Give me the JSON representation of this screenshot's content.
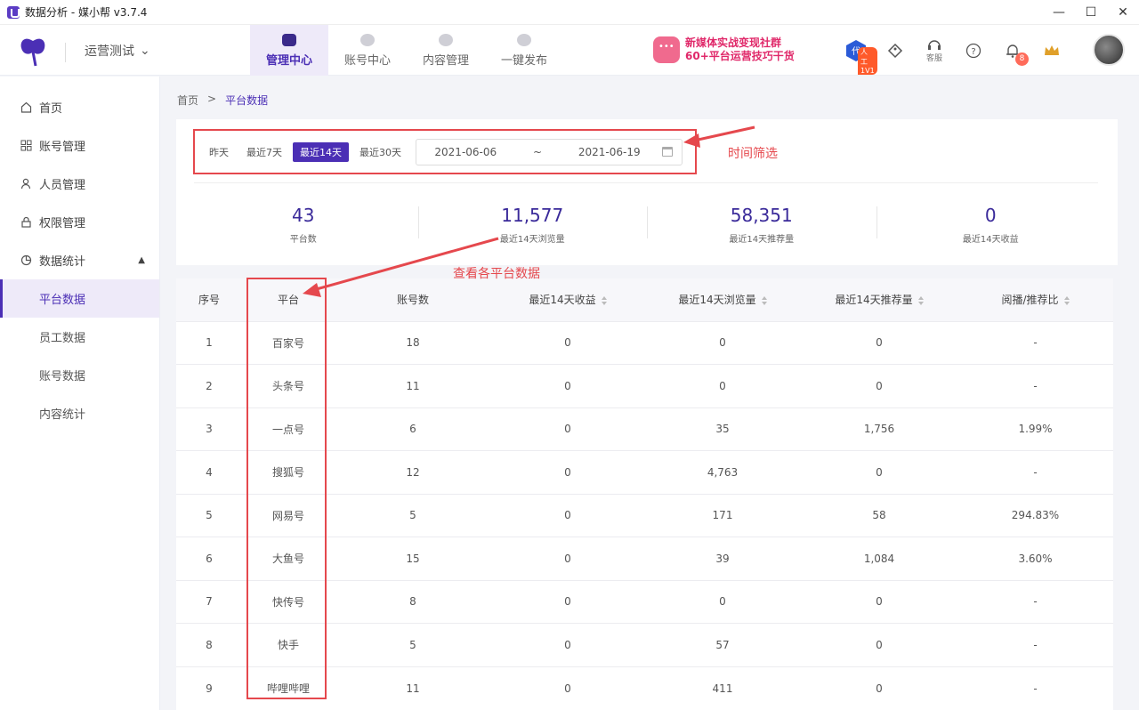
{
  "window": {
    "title": "数据分析 - 媒小帮 v3.7.4",
    "controls": [
      "—",
      "☐",
      "✕"
    ]
  },
  "header": {
    "org_label": "运营测试",
    "nav": [
      {
        "label": "管理中心",
        "icon": "monitor-icon",
        "active": true
      },
      {
        "label": "账号中心",
        "icon": "user-icon",
        "active": false
      },
      {
        "label": "内容管理",
        "icon": "document-icon",
        "active": false
      },
      {
        "label": "一键发布",
        "icon": "play-icon",
        "active": false
      }
    ],
    "promo_line1": "新媒体实战变现社群",
    "promo_line2": "60+平台运营技巧干货",
    "ai_badge": "人工1V1",
    "service_label": "客服",
    "notification_count": "8"
  },
  "sidebar": {
    "items": [
      {
        "label": "首页",
        "icon": "home-icon"
      },
      {
        "label": "账号管理",
        "icon": "grid-icon"
      },
      {
        "label": "人员管理",
        "icon": "person-icon"
      },
      {
        "label": "权限管理",
        "icon": "lock-icon"
      },
      {
        "label": "数据统计",
        "icon": "chart-icon"
      }
    ],
    "sub_items": [
      {
        "label": "平台数据",
        "active": true
      },
      {
        "label": "员工数据",
        "active": false
      },
      {
        "label": "账号数据",
        "active": false
      },
      {
        "label": "内容统计",
        "active": false
      }
    ]
  },
  "breadcrumb": {
    "home": "首页",
    "sep": ">",
    "current": "平台数据"
  },
  "filter": {
    "options": [
      "昨天",
      "最近7天",
      "最近14天",
      "最近30天"
    ],
    "active_index": 2,
    "start_date": "2021-06-06",
    "range_sep": "~",
    "end_date": "2021-06-19"
  },
  "stats": [
    {
      "value": "43",
      "label": "平台数"
    },
    {
      "value": "11,577",
      "label": "最近14天浏览量"
    },
    {
      "value": "58,351",
      "label": "最近14天推荐量"
    },
    {
      "value": "0",
      "label": "最近14天收益"
    }
  ],
  "table": {
    "headers": [
      "序号",
      "平台",
      "账号数",
      "最近14天收益",
      "最近14天浏览量",
      "最近14天推荐量",
      "阅播/推荐比"
    ],
    "rows": [
      [
        "1",
        "百家号",
        "18",
        "0",
        "0",
        "0",
        "-"
      ],
      [
        "2",
        "头条号",
        "11",
        "0",
        "0",
        "0",
        "-"
      ],
      [
        "3",
        "一点号",
        "6",
        "0",
        "35",
        "1,756",
        "1.99%"
      ],
      [
        "4",
        "搜狐号",
        "12",
        "0",
        "4,763",
        "0",
        "-"
      ],
      [
        "5",
        "网易号",
        "5",
        "0",
        "171",
        "58",
        "294.83%"
      ],
      [
        "6",
        "大鱼号",
        "15",
        "0",
        "39",
        "1,084",
        "3.60%"
      ],
      [
        "7",
        "快传号",
        "8",
        "0",
        "0",
        "0",
        "-"
      ],
      [
        "8",
        "快手",
        "5",
        "0",
        "57",
        "0",
        "-"
      ],
      [
        "9",
        "哔哩哔哩",
        "11",
        "0",
        "411",
        "0",
        "-"
      ]
    ]
  },
  "annotations": {
    "time_filter": "时间筛选",
    "platform_view": "查看各平台数据"
  },
  "colors": {
    "accent": "#4b2fb5",
    "annotation": "#e5484d"
  }
}
